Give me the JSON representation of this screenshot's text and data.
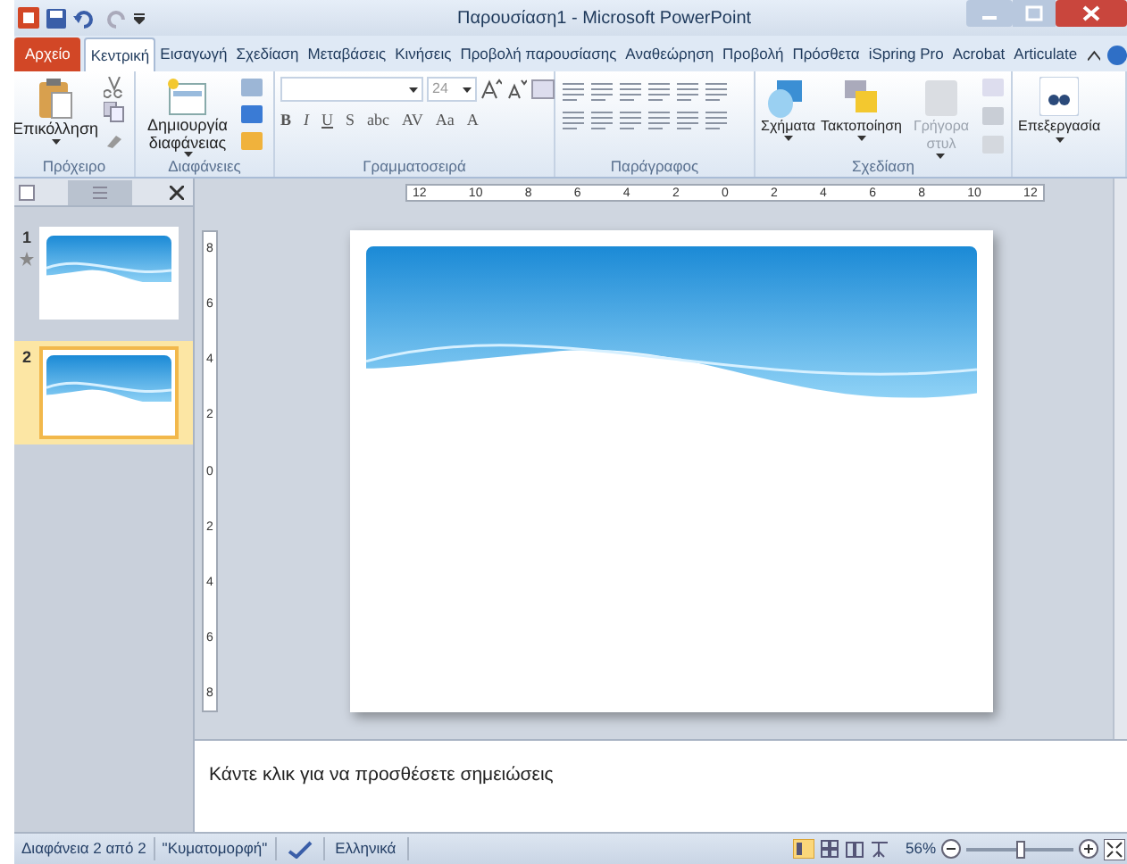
{
  "window": {
    "title": "Παρουσίαση1 - Microsoft PowerPoint"
  },
  "tabs": [
    {
      "label": "Αρχείο",
      "kind": "file",
      "selected": false
    },
    {
      "label": "Κεντρική",
      "kind": "tab",
      "selected": true
    },
    {
      "label": "Εισαγωγή",
      "kind": "tab",
      "selected": false
    },
    {
      "label": "Σχεδίαση",
      "kind": "tab",
      "selected": false
    },
    {
      "label": "Μεταβάσεις",
      "kind": "tab",
      "selected": false
    },
    {
      "label": "Κινήσεις",
      "kind": "tab",
      "selected": false
    },
    {
      "label": "Προβολή παρουσίασης",
      "kind": "tab",
      "selected": false
    },
    {
      "label": "Αναθεώρηση",
      "kind": "tab",
      "selected": false
    },
    {
      "label": "Προβολή",
      "kind": "tab",
      "selected": false
    },
    {
      "label": "Πρόσθετα",
      "kind": "tab",
      "selected": false
    },
    {
      "label": "iSpring Pro",
      "kind": "tab",
      "selected": false
    },
    {
      "label": "Acrobat",
      "kind": "tab",
      "selected": false
    },
    {
      "label": "Articulate",
      "kind": "tab",
      "selected": false
    }
  ],
  "ribbon": {
    "clipboard": {
      "label": "Πρόχειρο",
      "paste": "Επικόλληση"
    },
    "slides": {
      "label": "Διαφάνειες",
      "new_slide": "Δημιουργία διαφάνειας"
    },
    "font": {
      "label": "Γραμματοσειρά",
      "size": "24",
      "buttons": [
        "B",
        "I",
        "U",
        "S",
        "abc",
        "AV",
        "Aa",
        "A"
      ]
    },
    "paragraph": {
      "label": "Παράγραφος"
    },
    "drawing": {
      "label": "Σχεδίαση",
      "buttons": [
        {
          "label": "Σχήματα",
          "disabled": false
        },
        {
          "label": "Τακτοποίηση",
          "disabled": false
        },
        {
          "label": "Γρήγορα στυλ",
          "disabled": true
        }
      ]
    },
    "editing": {
      "button": "Επεξεργασία"
    }
  },
  "slide_pane": {
    "slides": [
      {
        "number": "1",
        "selected": false
      },
      {
        "number": "2",
        "selected": true
      }
    ]
  },
  "rulers": {
    "horizontal": [
      "12",
      "10",
      "8",
      "6",
      "4",
      "2",
      "0",
      "2",
      "4",
      "6",
      "8",
      "10",
      "12"
    ],
    "vertical": [
      "8",
      "6",
      "4",
      "2",
      "0",
      "2",
      "4",
      "6",
      "8"
    ]
  },
  "notes": {
    "placeholder": "Κάντε κλικ για να προσθέσετε σημειώσεις"
  },
  "status_bar": {
    "slide": "Διαφάνεια 2 από 2",
    "theme": "\"Κυματομορφή\"",
    "language": "Ελληνικά",
    "zoom": "56%",
    "level": 0.5
  }
}
